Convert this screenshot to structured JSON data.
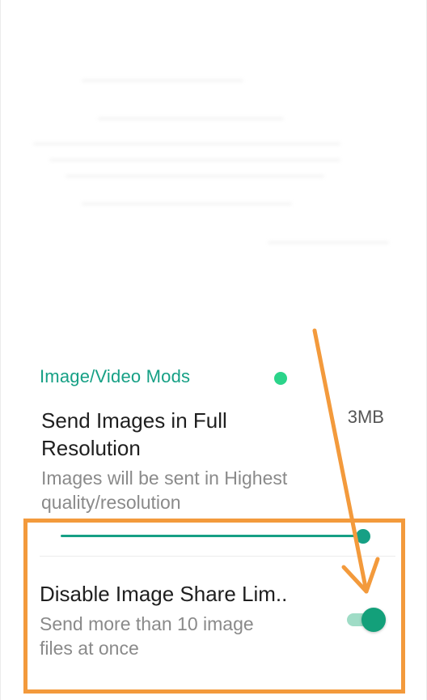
{
  "section": {
    "header": "Image/Video Mods"
  },
  "full_resolution": {
    "title_line1": "Send Images in Full",
    "title_line2": "Resolution",
    "summary_line1": "Images will be sent in Highest",
    "summary_line2": "quality/resolution",
    "value": "3MB",
    "slider_level": 0.98
  },
  "share_limit": {
    "title": "Disable Image Share Lim..",
    "summary_line1": "Send more than 10 image",
    "summary_line2": "files at once",
    "enabled": true
  },
  "colors": {
    "accent": "#16a085",
    "header_dot": "#2bd48a",
    "annotation": "#f39a3c",
    "toggle_thumb": "#13a07a",
    "toggle_track": "#9fdcc6"
  }
}
